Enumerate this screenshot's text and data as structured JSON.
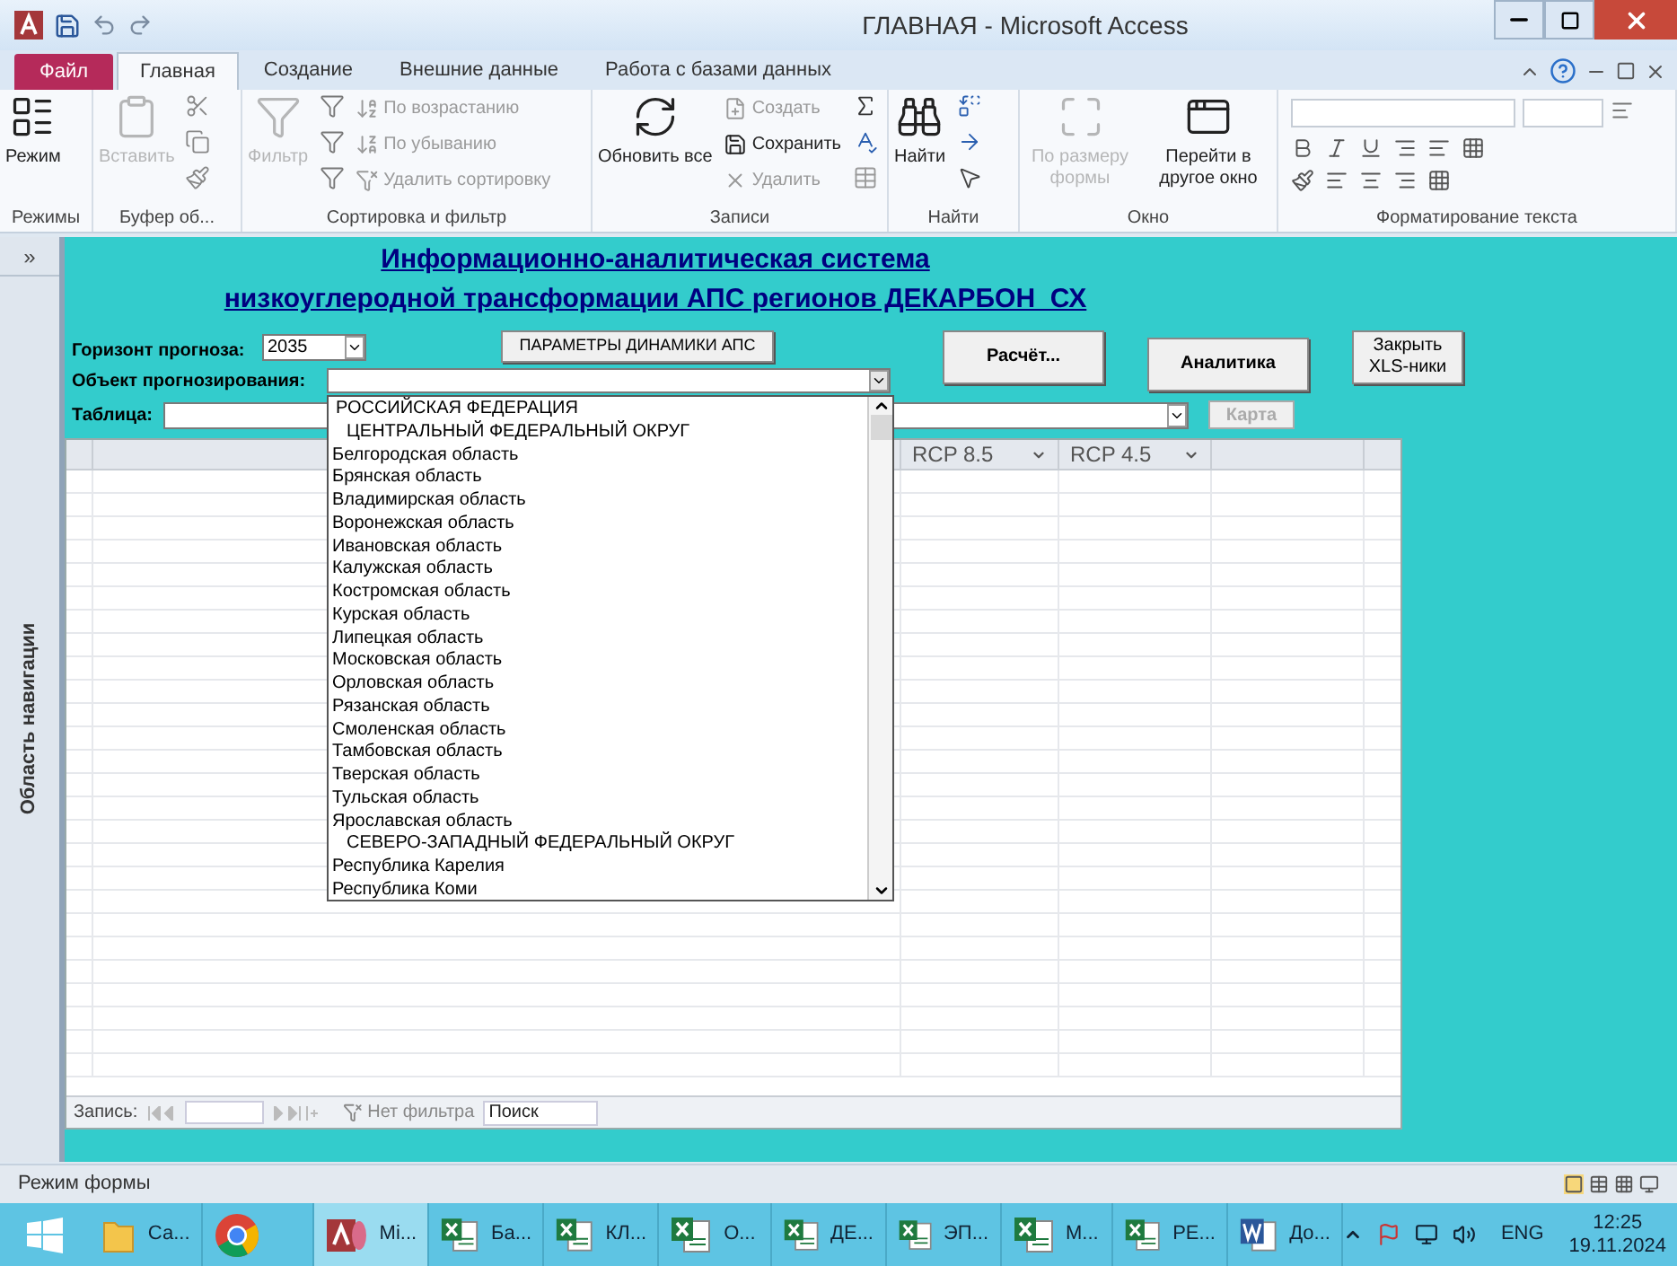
{
  "window": {
    "title": "ГЛАВНАЯ - Microsoft Access"
  },
  "ribbon": {
    "file_tab": "Файл",
    "tabs": [
      {
        "label": "Главная",
        "selected": true
      },
      {
        "label": "Создание",
        "selected": false
      },
      {
        "label": "Внешние данные",
        "selected": false
      },
      {
        "label": "Работа с базами данных",
        "selected": false
      }
    ],
    "groups": [
      {
        "label": "Режимы",
        "items": [
          {
            "kind": "large",
            "label": "Режим",
            "disabled": false
          }
        ]
      },
      {
        "label": "Буфер об...",
        "items": [
          {
            "kind": "large",
            "label": "Вставить",
            "disabled": true
          }
        ]
      },
      {
        "label": "Сортировка и фильтр",
        "items": [
          {
            "kind": "large",
            "label": "Фильтр",
            "disabled": true
          },
          {
            "kind": "small",
            "label": "По возрастанию",
            "disabled": true
          },
          {
            "kind": "small",
            "label": "По убыванию",
            "disabled": true
          },
          {
            "kind": "small",
            "label": "Удалить сортировку",
            "disabled": true
          }
        ]
      },
      {
        "label": "Записи",
        "items": [
          {
            "kind": "large",
            "label": "Обновить все",
            "disabled": false
          },
          {
            "kind": "small",
            "label": "Создать",
            "disabled": true
          },
          {
            "kind": "small",
            "label": "Сохранить",
            "disabled": false
          },
          {
            "kind": "small",
            "label": "Удалить",
            "disabled": true
          }
        ]
      },
      {
        "label": "Найти",
        "items": [
          {
            "kind": "large",
            "label": "Найти",
            "disabled": false
          }
        ]
      },
      {
        "label": "Окно",
        "items": [
          {
            "kind": "large",
            "label": "По размеру формы",
            "disabled": true
          },
          {
            "kind": "large",
            "label": "Перейти в другое окно",
            "disabled": false
          }
        ]
      },
      {
        "label": "Форматирование текста"
      }
    ]
  },
  "nav_pane": {
    "toggle": "»",
    "label": "Область навигации"
  },
  "form": {
    "title_lines": [
      "Информационно-аналитическая система",
      "низкоуглеродной трансформации АПС регионов ДЕКАРБОН_СХ"
    ],
    "horizon": {
      "label": "Горизонт прогноза:",
      "value": "2035"
    },
    "params_button": "ПАРАМЕТРЫ ДИНАМИКИ АПС",
    "buttons": [
      {
        "label": "Расчёт...",
        "bold": true
      },
      {
        "label": "Аналитика",
        "bold": true
      },
      {
        "label": "Закрыть XLS-ники",
        "bold": false
      }
    ],
    "object": {
      "label": "Объект прогнозирования:",
      "expanded": true
    },
    "table": {
      "label": "Таблица:"
    },
    "map_button": {
      "label": "Карта",
      "disabled": true
    },
    "dropdown": [
      {
        "kind": "country",
        "label": "РОССИЙСКАЯ ФЕДЕРАЦИЯ"
      },
      {
        "kind": "district",
        "label": "ЦЕНТРАЛЬНЫЙ ФЕДЕРАЛЬНЫЙ ОКРУГ"
      },
      {
        "kind": "region",
        "label": "Белгородская область"
      },
      {
        "kind": "region",
        "label": "Брянская область"
      },
      {
        "kind": "region",
        "label": "Владимирская область"
      },
      {
        "kind": "region",
        "label": "Воронежская область"
      },
      {
        "kind": "region",
        "label": "Ивановская область"
      },
      {
        "kind": "region",
        "label": "Калужская область"
      },
      {
        "kind": "region",
        "label": "Костромская область"
      },
      {
        "kind": "region",
        "label": "Курская область"
      },
      {
        "kind": "region",
        "label": "Липецкая область"
      },
      {
        "kind": "region",
        "label": "Московская область"
      },
      {
        "kind": "region",
        "label": "Орловская область"
      },
      {
        "kind": "region",
        "label": "Рязанская область"
      },
      {
        "kind": "region",
        "label": "Смоленская область"
      },
      {
        "kind": "region",
        "label": "Тамбовская область"
      },
      {
        "kind": "region",
        "label": "Тверская область"
      },
      {
        "kind": "region",
        "label": "Тульская область"
      },
      {
        "kind": "region",
        "label": "Ярославская область"
      },
      {
        "kind": "district",
        "label": "СЕВЕРО-ЗАПАДНЫЙ ФЕДЕРАЛЬНЫЙ ОКРУГ"
      },
      {
        "kind": "region",
        "label": "Республика Карелия"
      },
      {
        "kind": "region",
        "label": "Республика Коми"
      }
    ],
    "datasheet": {
      "columns": [
        "RCP 8.5",
        "RCP 4.5"
      ]
    },
    "record_nav": {
      "label": "Запись:",
      "filter": "Нет фильтра",
      "search_placeholder": "Поиск"
    }
  },
  "status_bar": {
    "text": "Режим формы"
  },
  "taskbar": {
    "items": [
      {
        "kind": "folder",
        "label": "Са...",
        "selected": false
      },
      {
        "kind": "chrome",
        "selected": false
      },
      {
        "kind": "access",
        "label": "Mi...",
        "selected": true
      },
      {
        "kind": "excel",
        "label": "Ба...",
        "selected": false
      },
      {
        "kind": "excel",
        "label": "КЛ...",
        "selected": false
      },
      {
        "kind": "excel",
        "label": "О...",
        "selected": false
      },
      {
        "kind": "excel",
        "label": "ДЕ...",
        "selected": false
      },
      {
        "kind": "excel",
        "label": "ЭП...",
        "selected": false
      },
      {
        "kind": "excel",
        "label": "М...",
        "selected": false
      },
      {
        "kind": "excel",
        "label": "РЕ...",
        "selected": false
      },
      {
        "kind": "word",
        "label": "До...",
        "selected": false
      }
    ],
    "language": "ENG",
    "time": "12:25",
    "date": "19.11.2024"
  }
}
